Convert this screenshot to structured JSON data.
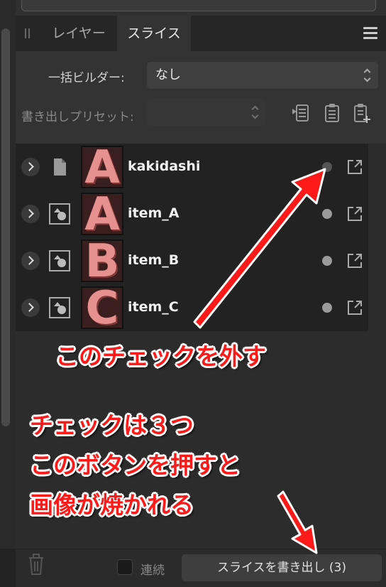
{
  "tabs": [
    {
      "label": "レイヤー",
      "active": false
    },
    {
      "label": "スライス",
      "active": true
    }
  ],
  "builder": {
    "label": "一括ビルダー:",
    "value": "なし"
  },
  "preset": {
    "label": "書き出しプリセット:",
    "value": ""
  },
  "slices": [
    {
      "name": "kakidashi",
      "thumb": "A",
      "type_icon": "document-icon",
      "checked": false
    },
    {
      "name": "item_A",
      "thumb": "A",
      "type_icon": "shape-layer-icon",
      "checked": true
    },
    {
      "name": "item_B",
      "thumb": "B",
      "type_icon": "shape-layer-icon",
      "checked": true
    },
    {
      "name": "item_C",
      "thumb": "C",
      "type_icon": "shape-layer-icon",
      "checked": true
    }
  ],
  "footer": {
    "continuous_label": "連続",
    "export_button_label": "スライスを書き出し (3)"
  },
  "annotations": {
    "uncheck": "このチェックを外す",
    "info_line1": "チェックは３つ",
    "info_line2": "このボタンを押すと",
    "info_line3": "画像が焼かれる"
  },
  "colors": {
    "annotation": "#ff1a1a",
    "annotation_outline": "#ffffff",
    "panel_bg": "#333333",
    "list_bg": "#222222",
    "thumb_letter": "#e79090"
  }
}
